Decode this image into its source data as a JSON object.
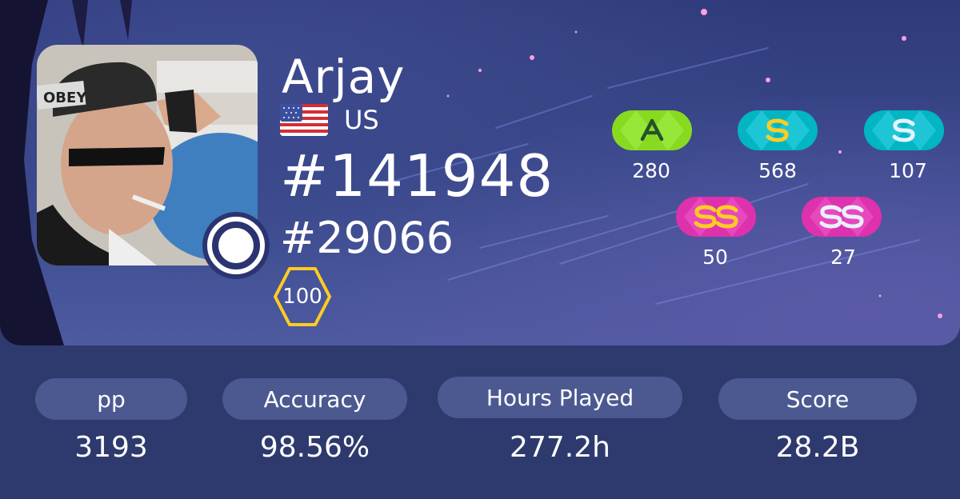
{
  "profile": {
    "username": "Arjay",
    "country_code": "US",
    "global_rank": "#141948",
    "country_rank": "#29066",
    "level": "100"
  },
  "grades": [
    {
      "grade": "A",
      "count": "280",
      "color": "#88da20"
    },
    {
      "grade": "S",
      "count": "568",
      "color": "#02b5c3"
    },
    {
      "grade": "S",
      "count": "107",
      "color": "#02b5c3"
    },
    {
      "grade": "SS",
      "count": "50",
      "color": "#de31ae"
    },
    {
      "grade": "SS",
      "count": "27",
      "color": "#de31ae"
    }
  ],
  "stats": [
    {
      "label": "pp",
      "value": "3193"
    },
    {
      "label": "Accuracy",
      "value": "98.56%"
    },
    {
      "label": "Hours Played",
      "value": "277.2h"
    },
    {
      "label": "Score",
      "value": "28.2B"
    }
  ],
  "colors": {
    "background": "#2e3a6e",
    "pill": "#4c5991",
    "level_border": "#ffcc22"
  },
  "icons": {
    "supporter": "supporter-icon",
    "flag": "us-flag-icon"
  }
}
